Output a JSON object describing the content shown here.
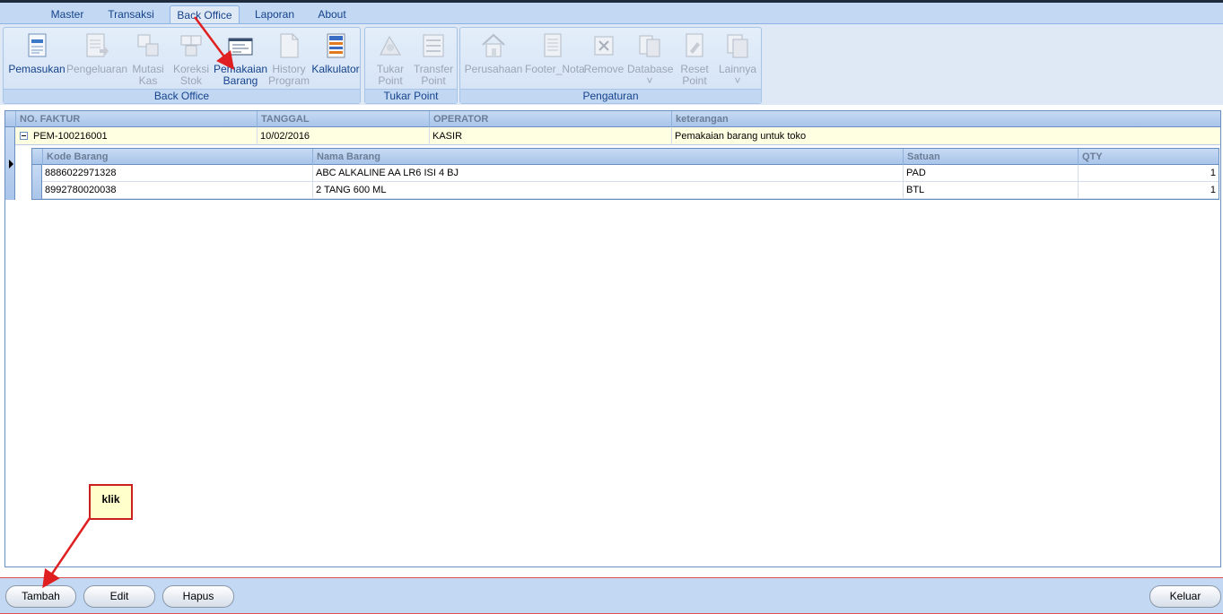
{
  "ribbon": {
    "tabs": [
      {
        "label": "Master"
      },
      {
        "label": "Transaksi"
      },
      {
        "label": "Back Office"
      },
      {
        "label": "Laporan"
      },
      {
        "label": "About"
      }
    ],
    "active_tab": "Back Office",
    "groups": {
      "back_office": {
        "label": "Back Office",
        "buttons": [
          {
            "label": "Pemasukan",
            "icon": "document-icon",
            "enabled": true
          },
          {
            "label": "Pengeluaran",
            "icon": "document-out-icon",
            "enabled": false
          },
          {
            "label": "Mutasi\nKas",
            "icon": "transfer-icon",
            "enabled": false
          },
          {
            "label": "Koreksi\nStok",
            "icon": "stock-correction-icon",
            "enabled": false
          },
          {
            "label": "Pemakaian\nBarang",
            "icon": "usage-form-icon",
            "enabled": true
          },
          {
            "label": "History\nProgram",
            "icon": "blank-page-icon",
            "enabled": false
          },
          {
            "label": "Kalkulator",
            "icon": "calculator-icon",
            "enabled": true
          }
        ]
      },
      "tukar_point": {
        "label": "Tukar Point",
        "buttons": [
          {
            "label": "Tukar\nPoint",
            "icon": "exchange-icon",
            "enabled": false
          },
          {
            "label": "Transfer\nPoint",
            "icon": "transfer-point-icon",
            "enabled": false
          }
        ]
      },
      "pengaturan": {
        "label": "Pengaturan",
        "buttons": [
          {
            "label": "Perusahaan",
            "icon": "home-icon",
            "enabled": false
          },
          {
            "label": "Footer_Nota",
            "icon": "note-icon",
            "enabled": false
          },
          {
            "label": "Remove",
            "icon": "remove-icon",
            "enabled": false
          },
          {
            "label": "Database\n˅",
            "icon": "database-icon",
            "enabled": false
          },
          {
            "label": "Reset\nPoint",
            "icon": "reset-icon",
            "enabled": false
          },
          {
            "label": "Lainnya\n˅",
            "icon": "more-icon",
            "enabled": false
          }
        ]
      }
    }
  },
  "grid": {
    "columns": [
      "NO. FAKTUR",
      "TANGGAL",
      "OPERATOR",
      "keterangan"
    ],
    "rows": [
      {
        "no_faktur": "PEM-100216001",
        "tanggal": "10/02/2016",
        "operator": "KASIR",
        "keterangan": "Pemakaian barang untuk toko",
        "detail": {
          "columns": [
            "Kode Barang",
            "Nama Barang",
            "Satuan",
            "QTY"
          ],
          "rows": [
            {
              "kode": "8886022971328",
              "nama": "ABC ALKALINE AA LR6 ISI 4 BJ",
              "satuan": "PAD",
              "qty": "1"
            },
            {
              "kode": "8992780020038",
              "nama": "2 TANG 600 ML",
              "satuan": "BTL",
              "qty": "1"
            }
          ]
        }
      }
    ]
  },
  "footer": {
    "tambah": "Tambah",
    "edit": "Edit",
    "hapus": "Hapus",
    "keluar": "Keluar"
  },
  "annotation": {
    "callout_text": "klik",
    "color": "#e02020"
  },
  "colors": {
    "ribbon_bg": "#dfe9f5",
    "header_text": "#6b7d97",
    "row_highlight": "#ffffe1"
  }
}
